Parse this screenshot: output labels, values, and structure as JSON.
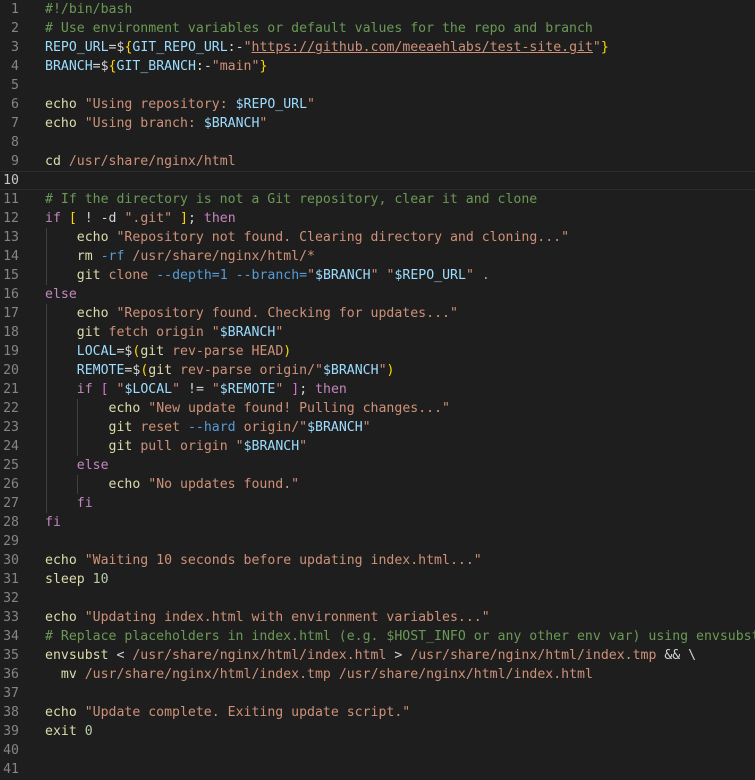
{
  "editor": {
    "language": "shellscript",
    "current_line": 10,
    "lines": [
      {
        "n": "1",
        "tokens": [
          [
            "c-comment",
            "#!/bin/bash"
          ]
        ]
      },
      {
        "n": "2",
        "tokens": [
          [
            "c-comment",
            "# Use environment variables or default values for the repo and branch"
          ]
        ]
      },
      {
        "n": "3",
        "tokens": [
          [
            "c-var",
            "REPO_URL"
          ],
          [
            "c-plain",
            "="
          ],
          [
            "c-plain",
            "$"
          ],
          [
            "c-brace",
            "{"
          ],
          [
            "c-var",
            "GIT_REPO_URL"
          ],
          [
            "c-plain",
            ":-"
          ],
          [
            "c-str",
            "\""
          ],
          [
            "c-url",
            "https://github.com/meeaehlabs/test-site.git"
          ],
          [
            "c-str",
            "\""
          ],
          [
            "c-brace",
            "}"
          ]
        ]
      },
      {
        "n": "4",
        "tokens": [
          [
            "c-var",
            "BRANCH"
          ],
          [
            "c-plain",
            "="
          ],
          [
            "c-plain",
            "$"
          ],
          [
            "c-brace",
            "{"
          ],
          [
            "c-var",
            "GIT_BRANCH"
          ],
          [
            "c-plain",
            ":-"
          ],
          [
            "c-str",
            "\"main\""
          ],
          [
            "c-brace",
            "}"
          ]
        ]
      },
      {
        "n": "5",
        "tokens": []
      },
      {
        "n": "6",
        "tokens": [
          [
            "c-fn",
            "echo"
          ],
          [
            "c-plain",
            " "
          ],
          [
            "c-str",
            "\"Using repository: "
          ],
          [
            "c-var",
            "$REPO_URL"
          ],
          [
            "c-str",
            "\""
          ]
        ]
      },
      {
        "n": "7",
        "tokens": [
          [
            "c-fn",
            "echo"
          ],
          [
            "c-plain",
            " "
          ],
          [
            "c-str",
            "\"Using branch: "
          ],
          [
            "c-var",
            "$BRANCH"
          ],
          [
            "c-str",
            "\""
          ]
        ]
      },
      {
        "n": "8",
        "tokens": []
      },
      {
        "n": "9",
        "tokens": [
          [
            "c-fn",
            "cd"
          ],
          [
            "c-plain",
            " "
          ],
          [
            "c-str",
            "/usr/share/nginx/html"
          ]
        ]
      },
      {
        "n": "10",
        "tokens": []
      },
      {
        "n": "11",
        "tokens": [
          [
            "c-comment",
            "# If the directory is not a Git repository, clear it and clone"
          ]
        ]
      },
      {
        "n": "12",
        "tokens": [
          [
            "c-kw",
            "if"
          ],
          [
            "c-plain",
            " "
          ],
          [
            "c-brace",
            "["
          ],
          [
            "c-plain",
            " ! -d "
          ],
          [
            "c-str",
            "\".git\""
          ],
          [
            "c-plain",
            " "
          ],
          [
            "c-brace",
            "]"
          ],
          [
            "c-plain",
            "; "
          ],
          [
            "c-kw",
            "then"
          ]
        ]
      },
      {
        "n": "13",
        "tokens": [
          [
            "c-plain",
            "    "
          ],
          [
            "c-fn",
            "echo"
          ],
          [
            "c-plain",
            " "
          ],
          [
            "c-str",
            "\"Repository not found. Clearing directory and cloning...\""
          ]
        ]
      },
      {
        "n": "14",
        "tokens": [
          [
            "c-plain",
            "    "
          ],
          [
            "c-fn",
            "rm"
          ],
          [
            "c-plain",
            " "
          ],
          [
            "c-op",
            "-rf"
          ],
          [
            "c-plain",
            " "
          ],
          [
            "c-str",
            "/usr/share/nginx/html/*"
          ]
        ]
      },
      {
        "n": "15",
        "tokens": [
          [
            "c-plain",
            "    "
          ],
          [
            "c-fn",
            "git"
          ],
          [
            "c-plain",
            " "
          ],
          [
            "c-str",
            "clone"
          ],
          [
            "c-plain",
            " "
          ],
          [
            "c-op",
            "--depth=1"
          ],
          [
            "c-plain",
            " "
          ],
          [
            "c-op",
            "--branch="
          ],
          [
            "c-str",
            "\""
          ],
          [
            "c-var",
            "$BRANCH"
          ],
          [
            "c-str",
            "\""
          ],
          [
            "c-plain",
            " "
          ],
          [
            "c-str",
            "\""
          ],
          [
            "c-var",
            "$REPO_URL"
          ],
          [
            "c-str",
            "\""
          ],
          [
            "c-plain",
            " "
          ],
          [
            "c-str",
            "."
          ]
        ]
      },
      {
        "n": "16",
        "tokens": [
          [
            "c-kw",
            "else"
          ]
        ]
      },
      {
        "n": "17",
        "tokens": [
          [
            "c-plain",
            "    "
          ],
          [
            "c-fn",
            "echo"
          ],
          [
            "c-plain",
            " "
          ],
          [
            "c-str",
            "\"Repository found. Checking for updates...\""
          ]
        ]
      },
      {
        "n": "18",
        "tokens": [
          [
            "c-plain",
            "    "
          ],
          [
            "c-fn",
            "git"
          ],
          [
            "c-plain",
            " "
          ],
          [
            "c-str",
            "fetch origin"
          ],
          [
            "c-plain",
            " "
          ],
          [
            "c-str",
            "\""
          ],
          [
            "c-var",
            "$BRANCH"
          ],
          [
            "c-str",
            "\""
          ]
        ]
      },
      {
        "n": "19",
        "tokens": [
          [
            "c-plain",
            "    "
          ],
          [
            "c-var",
            "LOCAL"
          ],
          [
            "c-plain",
            "="
          ],
          [
            "c-plain",
            "$"
          ],
          [
            "c-brace",
            "("
          ],
          [
            "c-fn",
            "git"
          ],
          [
            "c-plain",
            " "
          ],
          [
            "c-str",
            "rev-parse HEAD"
          ],
          [
            "c-brace",
            ")"
          ]
        ]
      },
      {
        "n": "20",
        "tokens": [
          [
            "c-plain",
            "    "
          ],
          [
            "c-var",
            "REMOTE"
          ],
          [
            "c-plain",
            "="
          ],
          [
            "c-plain",
            "$"
          ],
          [
            "c-brace",
            "("
          ],
          [
            "c-fn",
            "git"
          ],
          [
            "c-plain",
            " "
          ],
          [
            "c-str",
            "rev-parse origin/"
          ],
          [
            "c-str",
            "\""
          ],
          [
            "c-var",
            "$BRANCH"
          ],
          [
            "c-str",
            "\""
          ],
          [
            "c-brace",
            ")"
          ]
        ]
      },
      {
        "n": "21",
        "tokens": [
          [
            "c-plain",
            "    "
          ],
          [
            "c-kw",
            "if"
          ],
          [
            "c-plain",
            " "
          ],
          [
            "c-paren",
            "["
          ],
          [
            "c-plain",
            " "
          ],
          [
            "c-str",
            "\""
          ],
          [
            "c-var",
            "$LOCAL"
          ],
          [
            "c-str",
            "\""
          ],
          [
            "c-plain",
            " != "
          ],
          [
            "c-str",
            "\""
          ],
          [
            "c-var",
            "$REMOTE"
          ],
          [
            "c-str",
            "\""
          ],
          [
            "c-plain",
            " "
          ],
          [
            "c-paren",
            "]"
          ],
          [
            "c-plain",
            "; "
          ],
          [
            "c-kw",
            "then"
          ]
        ]
      },
      {
        "n": "22",
        "tokens": [
          [
            "c-plain",
            "        "
          ],
          [
            "c-fn",
            "echo"
          ],
          [
            "c-plain",
            " "
          ],
          [
            "c-str",
            "\"New update found! Pulling changes...\""
          ]
        ]
      },
      {
        "n": "23",
        "tokens": [
          [
            "c-plain",
            "        "
          ],
          [
            "c-fn",
            "git"
          ],
          [
            "c-plain",
            " "
          ],
          [
            "c-str",
            "reset"
          ],
          [
            "c-plain",
            " "
          ],
          [
            "c-op",
            "--hard"
          ],
          [
            "c-plain",
            " "
          ],
          [
            "c-str",
            "origin/"
          ],
          [
            "c-str",
            "\""
          ],
          [
            "c-var",
            "$BRANCH"
          ],
          [
            "c-str",
            "\""
          ]
        ]
      },
      {
        "n": "24",
        "tokens": [
          [
            "c-plain",
            "        "
          ],
          [
            "c-fn",
            "git"
          ],
          [
            "c-plain",
            " "
          ],
          [
            "c-str",
            "pull origin"
          ],
          [
            "c-plain",
            " "
          ],
          [
            "c-str",
            "\""
          ],
          [
            "c-var",
            "$BRANCH"
          ],
          [
            "c-str",
            "\""
          ]
        ]
      },
      {
        "n": "25",
        "tokens": [
          [
            "c-plain",
            "    "
          ],
          [
            "c-kw",
            "else"
          ]
        ]
      },
      {
        "n": "26",
        "tokens": [
          [
            "c-plain",
            "        "
          ],
          [
            "c-fn",
            "echo"
          ],
          [
            "c-plain",
            " "
          ],
          [
            "c-str",
            "\"No updates found.\""
          ]
        ]
      },
      {
        "n": "27",
        "tokens": [
          [
            "c-plain",
            "    "
          ],
          [
            "c-kw",
            "fi"
          ]
        ]
      },
      {
        "n": "28",
        "tokens": [
          [
            "c-kw",
            "fi"
          ]
        ]
      },
      {
        "n": "29",
        "tokens": []
      },
      {
        "n": "30",
        "tokens": [
          [
            "c-fn",
            "echo"
          ],
          [
            "c-plain",
            " "
          ],
          [
            "c-str",
            "\"Waiting 10 seconds before updating index.html...\""
          ]
        ]
      },
      {
        "n": "31",
        "tokens": [
          [
            "c-fn",
            "sleep"
          ],
          [
            "c-plain",
            " "
          ],
          [
            "c-num",
            "10"
          ]
        ]
      },
      {
        "n": "32",
        "tokens": []
      },
      {
        "n": "33",
        "tokens": [
          [
            "c-fn",
            "echo"
          ],
          [
            "c-plain",
            " "
          ],
          [
            "c-str",
            "\"Updating index.html with environment variables...\""
          ]
        ]
      },
      {
        "n": "34",
        "tokens": [
          [
            "c-comment",
            "# Replace placeholders in index.html (e.g. $HOST_INFO or any other env var) using envsubst."
          ]
        ]
      },
      {
        "n": "35",
        "tokens": [
          [
            "c-fn",
            "envsubst"
          ],
          [
            "c-plain",
            " < "
          ],
          [
            "c-str",
            "/usr/share/nginx/html/index.html"
          ],
          [
            "c-plain",
            " > "
          ],
          [
            "c-str",
            "/usr/share/nginx/html/index.tmp"
          ],
          [
            "c-plain",
            " && \\"
          ]
        ]
      },
      {
        "n": "36",
        "tokens": [
          [
            "c-plain",
            "  "
          ],
          [
            "c-fn",
            "mv"
          ],
          [
            "c-plain",
            " "
          ],
          [
            "c-str",
            "/usr/share/nginx/html/index.tmp"
          ],
          [
            "c-plain",
            " "
          ],
          [
            "c-str",
            "/usr/share/nginx/html/index.html"
          ]
        ]
      },
      {
        "n": "37",
        "tokens": []
      },
      {
        "n": "38",
        "tokens": [
          [
            "c-fn",
            "echo"
          ],
          [
            "c-plain",
            " "
          ],
          [
            "c-str",
            "\"Update complete. Exiting update script.\""
          ]
        ]
      },
      {
        "n": "39",
        "tokens": [
          [
            "c-fn",
            "exit"
          ],
          [
            "c-plain",
            " "
          ],
          [
            "c-num",
            "0"
          ]
        ]
      },
      {
        "n": "40",
        "tokens": []
      },
      {
        "n": "41",
        "tokens": []
      }
    ]
  }
}
